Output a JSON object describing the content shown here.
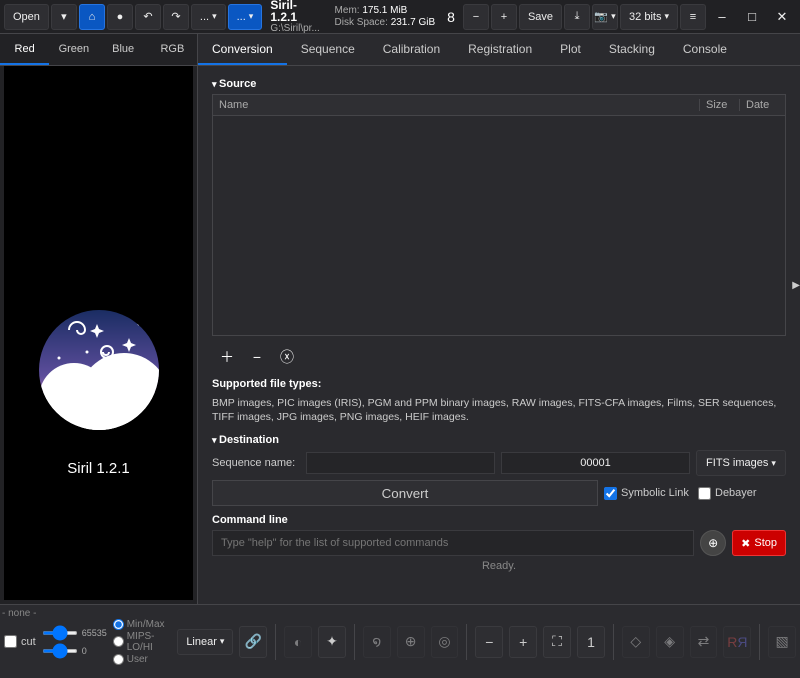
{
  "topbar": {
    "open": "Open",
    "dots": "...",
    "title": "Siril-1.2.1",
    "path": "G:\\Siril\\pr...",
    "mem_label": "Mem:",
    "mem": "175.1 MiB",
    "disk_label": "Disk Space:",
    "disk": "231.7 GiB",
    "threads": "8",
    "save": "Save",
    "bits": "32 bits"
  },
  "lefttabs": [
    "Red",
    "Green",
    "Blue",
    "RGB"
  ],
  "logotext": "Siril 1.2.1",
  "righttabs": [
    "Conversion",
    "Sequence",
    "Calibration",
    "Registration",
    "Plot",
    "Stacking",
    "Console"
  ],
  "source": {
    "head": "Source",
    "cols": {
      "name": "Name",
      "size": "Size",
      "date": "Date"
    }
  },
  "supported_head": "Supported file types:",
  "supported_text": "BMP images, PIC images (IRIS), PGM and PPM binary images, RAW images, FITS-CFA images, Films, SER sequences, TIFF images, JPG images, PNG images, HEIF images.",
  "dest": {
    "head": "Destination",
    "seqlabel": "Sequence name:",
    "seqnum": "00001",
    "format": "FITS images",
    "convert": "Convert",
    "symlink": "Symbolic Link",
    "debayer": "Debayer"
  },
  "cmd": {
    "label": "Command line",
    "placeholder": "Type \"help\" for the list of supported commands",
    "stop": "Stop",
    "ready": "Ready."
  },
  "bottom": {
    "none": "- none -",
    "hi": "65535",
    "lo": "0",
    "cut": "cut",
    "minmax": "Min/Max",
    "mips": "MIPS-LO/HI",
    "user": "User",
    "linear": "Linear",
    "one": "1"
  }
}
